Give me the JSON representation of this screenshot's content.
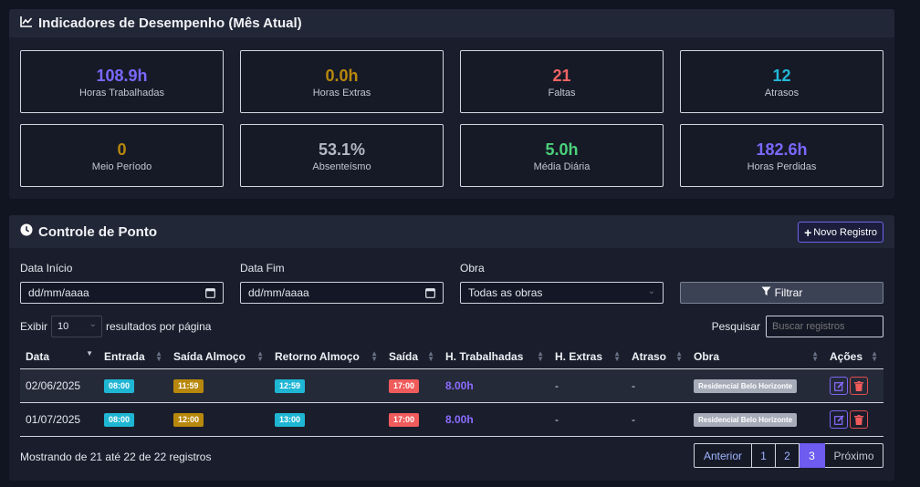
{
  "kpi_section": {
    "title": "Indicadores de Desempenho (Mês Atual)",
    "cards": [
      {
        "value": "108.9h",
        "label": "Horas Trabalhadas",
        "color": "#7b68ff"
      },
      {
        "value": "0.0h",
        "label": "Horas Extras",
        "color": "#b8880c"
      },
      {
        "value": "21",
        "label": "Faltas",
        "color": "#f06464"
      },
      {
        "value": "12",
        "label": "Atrasos",
        "color": "#22b8d6"
      },
      {
        "value": "0",
        "label": "Meio Período",
        "color": "#b8880c"
      },
      {
        "value": "53.1%",
        "label": "Absenteísmo",
        "color": "#b4b8c4"
      },
      {
        "value": "5.0h",
        "label": "Média Diária",
        "color": "#4bd07a"
      },
      {
        "value": "182.6h",
        "label": "Horas Perdidas",
        "color": "#7b68ff"
      }
    ]
  },
  "ponto_section": {
    "title": "Controle de Ponto",
    "novo_registro_label": "Novo Registro",
    "filters": {
      "data_inicio_label": "Data Início",
      "data_inicio_value": "dd/mm/aaaa",
      "data_fim_label": "Data Fim",
      "data_fim_value": "dd/mm/aaaa",
      "obra_label": "Obra",
      "obra_value": "Todas as obras",
      "filtrar_label": "Filtrar"
    },
    "length": {
      "prefix": "Exibir",
      "value": "10",
      "suffix": "resultados por página"
    },
    "search": {
      "label": "Pesquisar",
      "placeholder": "Buscar registros"
    },
    "columns": [
      "Data",
      "Entrada",
      "Saída Almoço",
      "Retorno Almoço",
      "Saída",
      "H. Trabalhadas",
      "H. Extras",
      "Atraso",
      "Obra",
      "Ações"
    ],
    "rows": [
      {
        "data": "02/06/2025",
        "entrada": "08:00",
        "saida_almoco": "11:59",
        "retorno_almoco": "12:59",
        "saida": "17:00",
        "h_trabalhadas": "8.00h",
        "h_extras": "-",
        "atraso": "-",
        "obra": "Residencial Belo Horizonte"
      },
      {
        "data": "01/07/2025",
        "entrada": "08:00",
        "saida_almoco": "12:00",
        "retorno_almoco": "13:00",
        "saida": "17:00",
        "h_trabalhadas": "8.00h",
        "h_extras": "-",
        "atraso": "-",
        "obra": "Residencial Belo Horizonte"
      }
    ],
    "info": "Mostrando de 21 até 22 de 22 registros",
    "pagination": {
      "prev": "Anterior",
      "pages": [
        "1",
        "2",
        "3"
      ],
      "active": "3",
      "next": "Próximo"
    }
  }
}
